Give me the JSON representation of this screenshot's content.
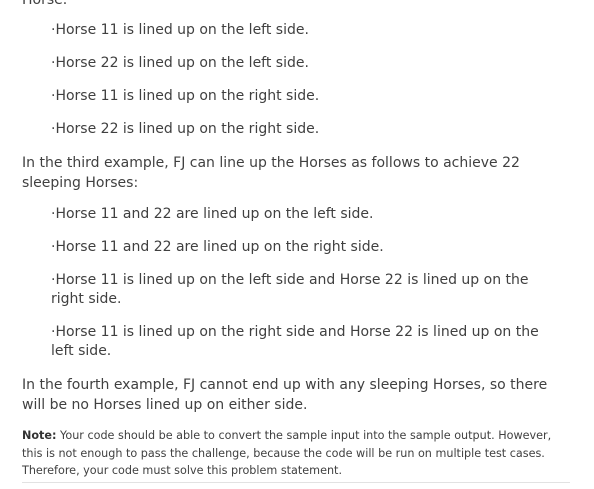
{
  "cut_text": "Horse.",
  "list1": [
    "·Horse 11 is lined up on the left side.",
    "·Horse 22 is lined up on the left side.",
    "·Horse 11 is lined up on the right side.",
    "·Horse 22 is lined up on the right side."
  ],
  "para_third": "In the third example, FJ can line up the Horses as follows to achieve 22 sleeping Horses:",
  "list2": [
    "·Horse 11 and 22 are lined up on the left side.",
    "·Horse 11 and 22 are lined up on the right side.",
    "·Horse 11 is lined up on the left side and Horse 22 is lined up on the right side.",
    "·Horse 11 is lined up on the right side and Horse 22 is lined up on the left side."
  ],
  "para_fourth": "In the fourth example, FJ cannot end up with any sleeping Horses, so there will be no Horses lined up on either side.",
  "note": {
    "label": "Note:",
    "text": " Your code should be able to convert the sample input into the sample output. However, this is not enough to pass the challenge, because the code will be run on multiple test cases. Therefore, your code must solve this problem statement."
  }
}
